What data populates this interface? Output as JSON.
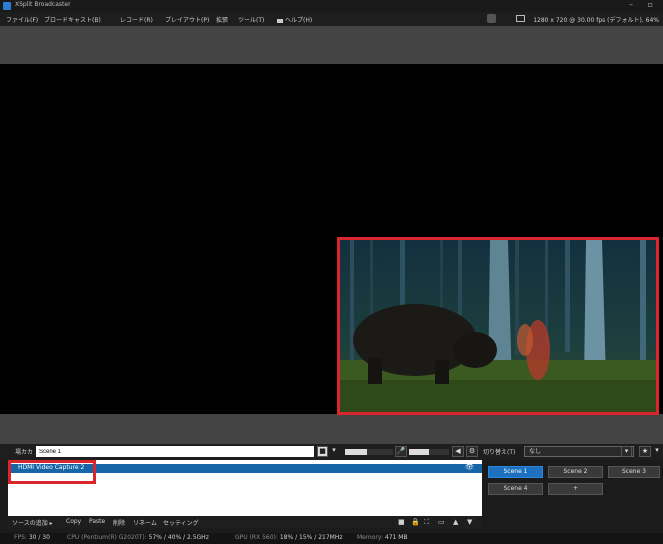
{
  "window": {
    "title": "XSplit Broadcaster",
    "controls": "– ▫"
  },
  "menubar": {
    "items": [
      "ファイル(F)",
      "ブロードキャスト(B)",
      "レコード(R)",
      "プレイアウト(P)",
      "拡張",
      "ツール(T)",
      "ヘルプ(H)"
    ],
    "resolution": "1280 x 720 @ 30.00 fps (デフォルト), 64%"
  },
  "scene_bar": {
    "label": "場カカ",
    "scene_name": "Scene 1",
    "transition_label": "切り替え(T)",
    "transition_value": "なし"
  },
  "sources": {
    "items": [
      {
        "name": "HDMI Video Capture 2",
        "visible": true
      }
    ]
  },
  "source_toolbar": {
    "add": "ソースの追加 ▸",
    "copy": "Copy",
    "paste": "Paste",
    "delete": "削除",
    "rename": "リネーム",
    "settings": "セッティング"
  },
  "scenes": {
    "buttons": [
      "Scene 1",
      "Scene 2",
      "Scene 3",
      "Scene 4",
      "+"
    ],
    "active": "Scene 1"
  },
  "status": {
    "fps_label": "FPS:",
    "fps_value": "30 / 30",
    "cpu_label": "CPU (Pentium(R) G2020T):",
    "cpu_value": "57% / 40% / 2.5GHz",
    "gpu_label": "GPU (RX 560):",
    "gpu_value": "18% / 15% / 217MHz",
    "mem_label": "Memory:",
    "mem_value": "471 MB"
  },
  "colors": {
    "accent": "#1d6fbf",
    "highlight": "#d9262c"
  }
}
